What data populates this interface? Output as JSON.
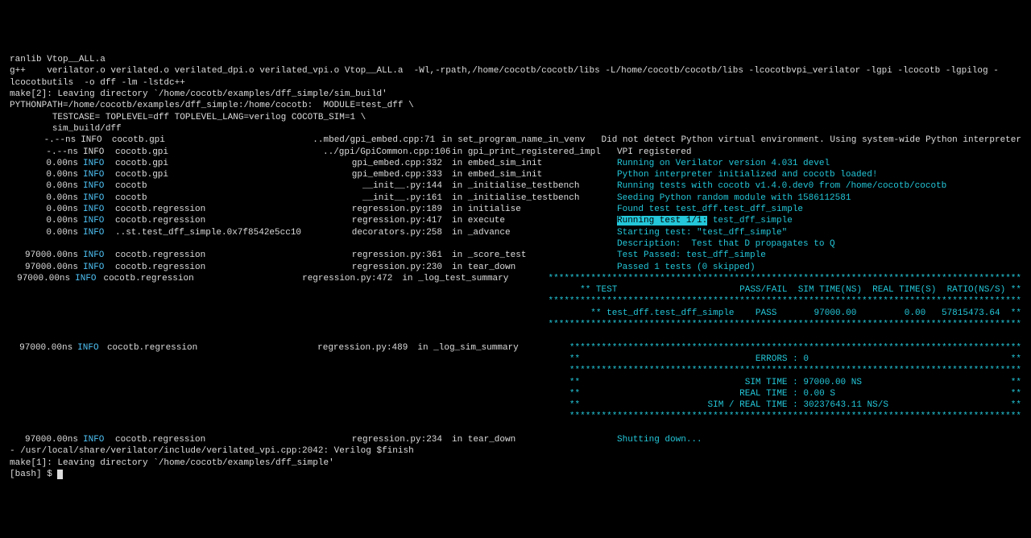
{
  "header": {
    "l1": "ranlib Vtop__ALL.a",
    "l2": "g++    verilator.o verilated.o verilated_dpi.o verilated_vpi.o Vtop__ALL.a  -Wl,-rpath,/home/cocotb/cocotb/libs -L/home/cocotb/cocotb/libs -lcocotbvpi_verilator -lgpi -lcocotb -lgpilog -lcocotbutils  -o dff -lm -lstdc++",
    "l3": "make[2]: Leaving directory `/home/cocotb/examples/dff_simple/sim_build'",
    "l4": "PYTHONPATH=/home/cocotb/examples/dff_simple:/home/cocotb:  MODULE=test_dff \\",
    "l5": "        TESTCASE= TOPLEVEL=dff TOPLEVEL_LANG=verilog COCOTB_SIM=1 \\",
    "l6": "        sim_build/dff"
  },
  "rows": [
    {
      "t": "-.--ns",
      "lvl": "INFO",
      "log": "cocotb.gpi",
      "src": "..mbed/gpi_embed.cpp:71",
      "fn": "in set_program_name_in_venv",
      "msg": "Did not detect Python virtual environment. Using system-wide Python interpreter",
      "c": false
    },
    {
      "t": "-.--ns",
      "lvl": "INFO",
      "log": "cocotb.gpi",
      "src": "../gpi/GpiCommon.cpp:106",
      "fn": "in gpi_print_registered_impl",
      "msg": "VPI registered",
      "c": false
    },
    {
      "t": "0.00ns",
      "lvl": "INFO",
      "log": "cocotb.gpi",
      "src": "gpi_embed.cpp:332",
      "fn": "in embed_sim_init",
      "msg": "Running on Verilator version 4.031 devel",
      "c": true,
      "i": true
    },
    {
      "t": "0.00ns",
      "lvl": "INFO",
      "log": "cocotb.gpi",
      "src": "gpi_embed.cpp:333",
      "fn": "in embed_sim_init",
      "msg": "Python interpreter initialized and cocotb loaded!",
      "c": true,
      "i": true
    },
    {
      "t": "0.00ns",
      "lvl": "INFO",
      "log": "cocotb",
      "src": "__init__.py:144",
      "fn": "in _initialise_testbench",
      "msg": "Running tests with cocotb v1.4.0.dev0 from /home/cocotb/cocotb",
      "c": true,
      "i": true
    },
    {
      "t": "0.00ns",
      "lvl": "INFO",
      "log": "cocotb",
      "src": "__init__.py:161",
      "fn": "in _initialise_testbench",
      "msg": "Seeding Python random module with 1586112581",
      "c": true,
      "i": true
    },
    {
      "t": "0.00ns",
      "lvl": "INFO",
      "log": "cocotb.regression",
      "src": "regression.py:189",
      "fn": "in initialise",
      "msg": "Found test test_dff.test_dff_simple",
      "c": true,
      "i": true
    },
    {
      "t": "0.00ns",
      "lvl": "INFO",
      "log": "cocotb.regression",
      "src": "regression.py:417",
      "fn": "in execute",
      "msgA": "Running test 1/1:",
      "msgB": " test_dff_simple",
      "c": true,
      "i": true,
      "special": "hl"
    },
    {
      "t": "0.00ns",
      "lvl": "INFO",
      "log": "..st.test_dff_simple.0x7f8542e5cc10",
      "src": "decorators.py:258",
      "fn": "in _advance",
      "msg": "Starting test: \"test_dff_simple\"",
      "c": true,
      "i": true
    },
    {
      "t": "",
      "lvl": "",
      "log": "",
      "src": "",
      "fn": "",
      "msg": "Description:  Test that D propagates to Q",
      "c": true
    },
    {
      "t": "97000.00ns",
      "lvl": "INFO",
      "log": "cocotb.regression",
      "src": "regression.py:361",
      "fn": "in _score_test",
      "msg": "Test Passed: test_dff_simple",
      "c": true,
      "i": true
    },
    {
      "t": "97000.00ns",
      "lvl": "INFO",
      "log": "cocotb.regression",
      "src": "regression.py:230",
      "fn": "in tear_down",
      "msg": "Passed 1 tests (0 skipped)",
      "c": true,
      "i": true
    },
    {
      "t": "97000.00ns",
      "lvl": "INFO",
      "log": "cocotb.regression",
      "src": "regression.py:472",
      "fn": "in _log_test_summary",
      "msg": "*****************************************************************************************",
      "c": true,
      "i": true
    },
    {
      "t": "",
      "lvl": "",
      "log": "",
      "src": "",
      "fn": "",
      "msg": "** TEST                       PASS/FAIL  SIM TIME(NS)  REAL TIME(S)  RATIO(NS/S) **",
      "c": true
    },
    {
      "t": "",
      "lvl": "",
      "log": "",
      "src": "",
      "fn": "",
      "msg": "*****************************************************************************************",
      "c": true
    },
    {
      "t": "",
      "lvl": "",
      "log": "",
      "src": "",
      "fn": "",
      "msg": "** test_dff.test_dff_simple    PASS       97000.00         0.00   57815473.64  **",
      "c": true
    },
    {
      "t": "",
      "lvl": "",
      "log": "",
      "src": "",
      "fn": "",
      "msg": "*****************************************************************************************",
      "c": true
    },
    {
      "blank": true
    },
    {
      "t": "97000.00ns",
      "lvl": "INFO",
      "log": "cocotb.regression",
      "src": "regression.py:489",
      "fn": "in _log_sim_summary",
      "msg": "*************************************************************************************",
      "c": true,
      "i": true
    },
    {
      "t": "",
      "lvl": "",
      "log": "",
      "src": "",
      "fn": "",
      "msg": "**                                 ERRORS : 0                                      **",
      "c": true
    },
    {
      "t": "",
      "lvl": "",
      "log": "",
      "src": "",
      "fn": "",
      "msg": "*************************************************************************************",
      "c": true
    },
    {
      "t": "",
      "lvl": "",
      "log": "",
      "src": "",
      "fn": "",
      "msg": "**                               SIM TIME : 97000.00 NS                            **",
      "c": true
    },
    {
      "t": "",
      "lvl": "",
      "log": "",
      "src": "",
      "fn": "",
      "msg": "**                              REAL TIME : 0.00 S                                 **",
      "c": true
    },
    {
      "t": "",
      "lvl": "",
      "log": "",
      "src": "",
      "fn": "",
      "msg": "**                        SIM / REAL TIME : 30237643.11 NS/S                       **",
      "c": true
    },
    {
      "t": "",
      "lvl": "",
      "log": "",
      "src": "",
      "fn": "",
      "msg": "*************************************************************************************",
      "c": true
    },
    {
      "blank": true
    },
    {
      "t": "97000.00ns",
      "lvl": "INFO",
      "log": "cocotb.regression",
      "src": "regression.py:234",
      "fn": "in tear_down",
      "msg": "Shutting down...",
      "c": true,
      "i": true
    }
  ],
  "footer": {
    "l1": "- /usr/local/share/verilator/include/verilated_vpi.cpp:2042: Verilog $finish",
    "l2": "make[1]: Leaving directory `/home/cocotb/examples/dff_simple'",
    "prompt": "[bash] $ "
  }
}
